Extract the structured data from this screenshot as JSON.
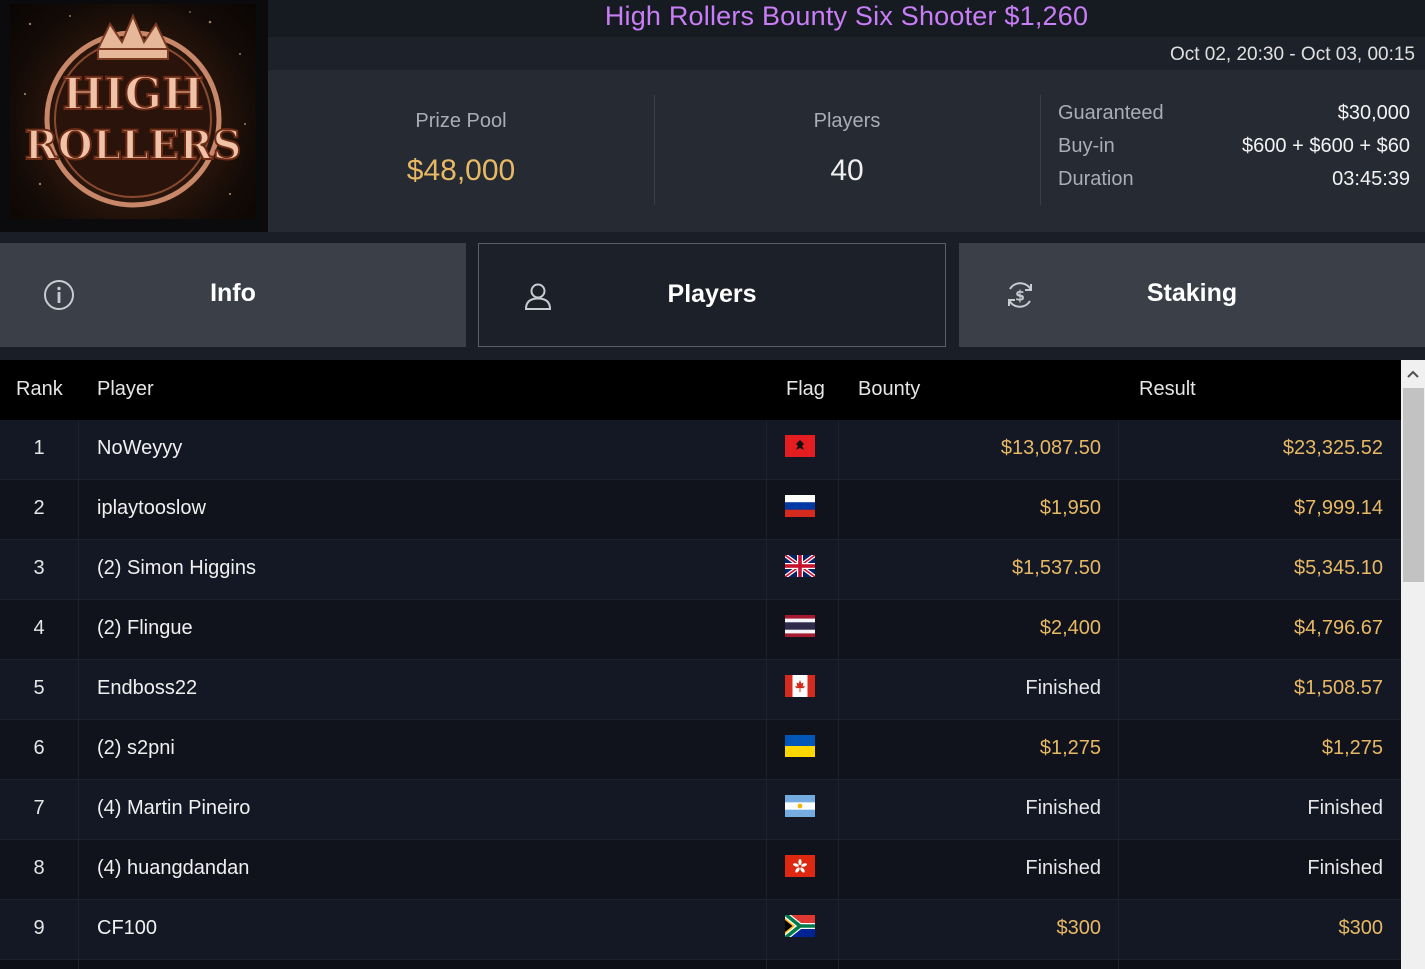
{
  "tournament": {
    "title": "High Rollers Bounty Six Shooter $1,260",
    "dates": "Oct 02, 20:30 - Oct 03, 00:15",
    "logo_text": [
      "HIGH",
      "ROLLERS"
    ]
  },
  "stats": {
    "prize_pool_label": "Prize Pool",
    "prize_pool_value": "$48,000",
    "players_label": "Players",
    "players_value": "40"
  },
  "details": {
    "guaranteed_label": "Guaranteed",
    "guaranteed_value": "$30,000",
    "buyin_label": "Buy-in",
    "buyin_value": "$600 + $600 + $60",
    "duration_label": "Duration",
    "duration_value": "03:45:39"
  },
  "tabs": {
    "info": "Info",
    "players": "Players",
    "staking": "Staking",
    "active": "players"
  },
  "table": {
    "headers": {
      "rank": "Rank",
      "player": "Player",
      "flag": "Flag",
      "bounty": "Bounty",
      "result": "Result"
    },
    "rows": [
      {
        "rank": "1",
        "player": "NoWeyyy",
        "flag": "albania",
        "bounty": "$13,087.50",
        "result": "$23,325.52"
      },
      {
        "rank": "2",
        "player": "iplaytooslow",
        "flag": "russia",
        "bounty": "$1,950",
        "result": "$7,999.14"
      },
      {
        "rank": "3",
        "player": "(2) Simon Higgins",
        "flag": "united-kingdom",
        "bounty": "$1,537.50",
        "result": "$5,345.10"
      },
      {
        "rank": "4",
        "player": "(2) Flingue",
        "flag": "thailand",
        "bounty": "$2,400",
        "result": "$4,796.67"
      },
      {
        "rank": "5",
        "player": "Endboss22",
        "flag": "canada",
        "bounty": "Finished",
        "result": "$1,508.57"
      },
      {
        "rank": "6",
        "player": "(2) s2pni",
        "flag": "ukraine",
        "bounty": "$1,275",
        "result": "$1,275"
      },
      {
        "rank": "7",
        "player": "(4) Martin Pineiro",
        "flag": "argentina",
        "bounty": "Finished",
        "result": "Finished"
      },
      {
        "rank": "8",
        "player": "(4) huangdandan",
        "flag": "hong-kong",
        "bounty": "Finished",
        "result": "Finished"
      },
      {
        "rank": "9",
        "player": "CF100",
        "flag": "south-africa",
        "bounty": "$300",
        "result": "$300"
      }
    ]
  },
  "colors": {
    "title": "#c97ef7",
    "money": "#e8b964",
    "header_bg": "#252a33",
    "tab_bg": "#3a3f48",
    "active_tab_bg": "#1c2028"
  }
}
